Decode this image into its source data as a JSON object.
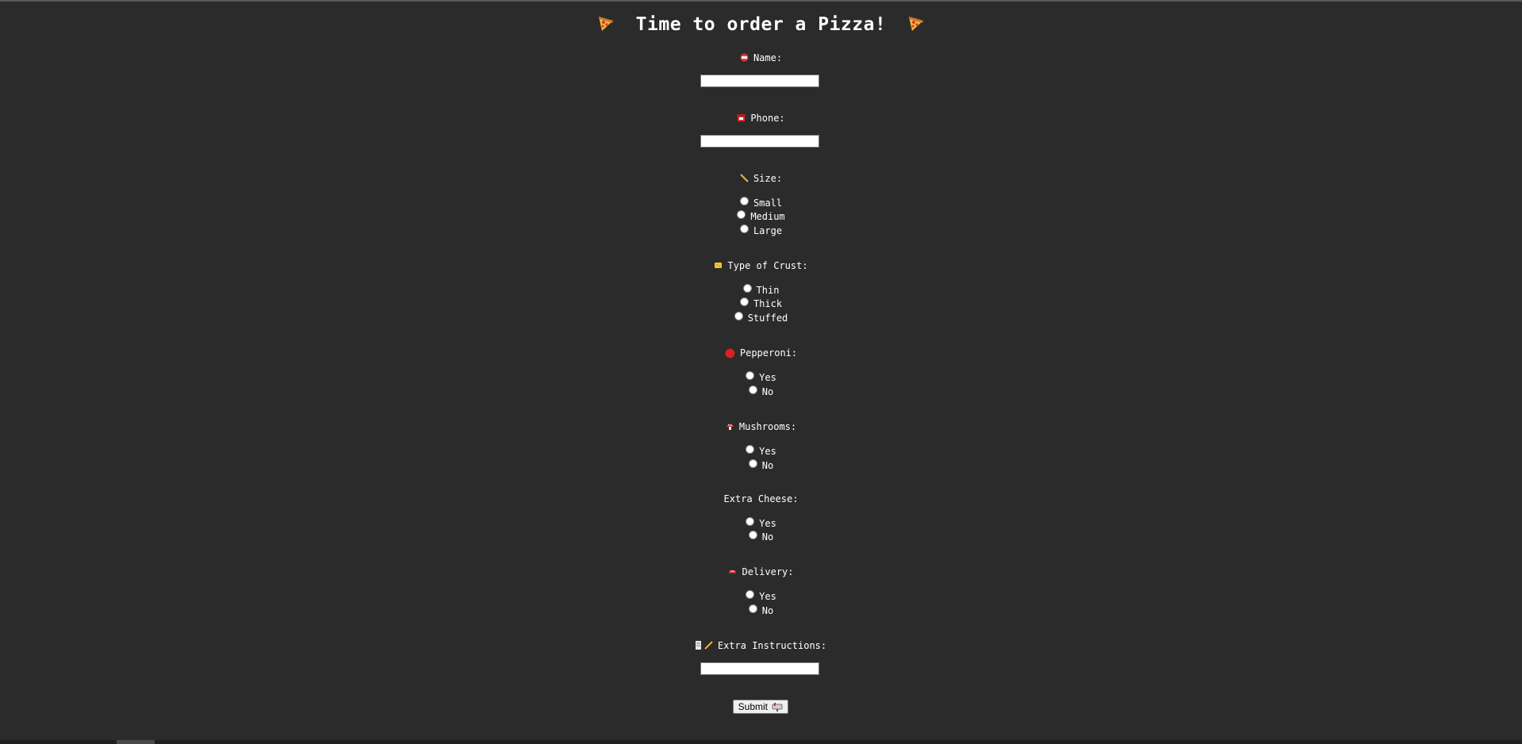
{
  "title": "Time to order a Pizza!",
  "icons": {
    "title_left": "pizza-slice-icon",
    "title_right": "pizza-slice-icon",
    "name": "name-badge-icon",
    "phone": "telephone-icon",
    "size": "ruler-icon",
    "crust": "cheese-icon",
    "pepperoni": "red-circle-icon",
    "mushrooms": "mushroom-icon",
    "delivery": "car-icon",
    "instructions": "memo-pencil-icon",
    "submit": "mailbox-icon"
  },
  "form": {
    "name_label": "Name:",
    "name_value": "",
    "phone_label": "Phone:",
    "phone_value": "",
    "size_label": "Size:",
    "size_options": [
      "Small",
      "Medium",
      "Large"
    ],
    "crust_label": "Type of Crust:",
    "crust_options": [
      "Thin",
      "Thick",
      "Stuffed"
    ],
    "pepperoni_label": "Pepperoni:",
    "mushrooms_label": "Mushrooms:",
    "cheese_label": "Extra Cheese:",
    "delivery_label": "Delivery:",
    "yes_label": "Yes",
    "no_label": "No",
    "instructions_label": "Extra Instructions:",
    "instructions_value": "",
    "submit_label": "Submit"
  },
  "colors": {
    "background": "#2b2b2b",
    "text": "#ffffff"
  }
}
